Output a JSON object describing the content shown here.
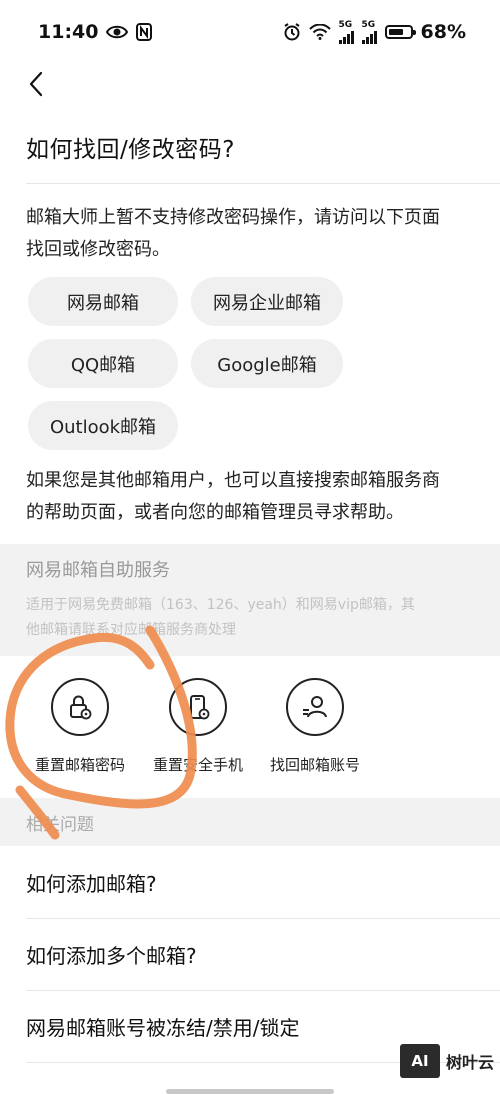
{
  "status_bar": {
    "time": "11:40",
    "network": "5G",
    "network2": "5G",
    "battery": "68%",
    "battery_level": 0.68
  },
  "page": {
    "title": "如何找回/修改密码?",
    "intro_line1": "邮箱大师上暂不支持修改密码操作，请访问以下页面",
    "intro_line2": "找回或修改密码。",
    "outro_line1": "如果您是其他邮箱用户，也可以直接搜索邮箱服务商",
    "outro_line2": "的帮助页面，或者向您的邮箱管理员寻求帮助。"
  },
  "chips": [
    "网易邮箱",
    "网易企业邮箱",
    "QQ邮箱",
    "Google邮箱",
    "Outlook邮箱"
  ],
  "self_service": {
    "title": "网易邮箱自助服务",
    "desc_line1": "适用于网易免费邮箱（163、126、yeah）和网易vip邮箱，其",
    "desc_line2": "他邮箱请联系对应邮箱服务商处理",
    "actions": [
      {
        "label": "重置邮箱密码",
        "icon": "lock-icon"
      },
      {
        "label": "重置安全手机",
        "icon": "phone-icon"
      },
      {
        "label": "找回邮箱账号",
        "icon": "user-icon"
      }
    ]
  },
  "related": {
    "title": "相关问题",
    "items": [
      "如何添加邮箱?",
      "如何添加多个邮箱?",
      "网易邮箱账号被冻结/禁用/锁定"
    ]
  },
  "watermark": {
    "badge": "AI",
    "text": "树叶云"
  },
  "colors": {
    "chip_bg": "#f0f0f0",
    "panel_bg": "#f2f2f2",
    "scribble": "#ef8d4f"
  }
}
